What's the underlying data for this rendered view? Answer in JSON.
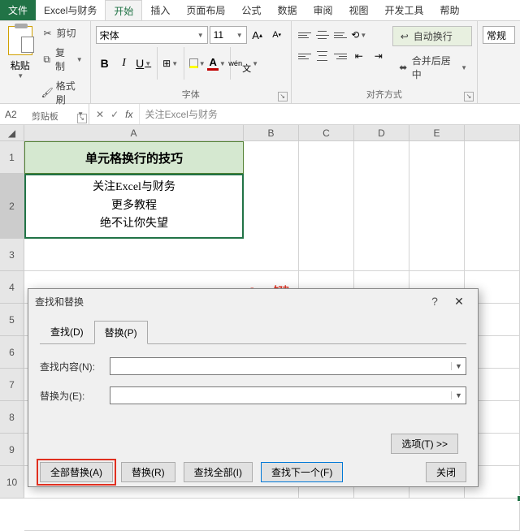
{
  "tabs": {
    "file": "文件",
    "context": "Excel与财务",
    "home": "开始",
    "insert": "插入",
    "layout": "页面布局",
    "formula": "公式",
    "data": "数据",
    "review": "审阅",
    "view": "视图",
    "dev": "开发工具",
    "help": "帮助"
  },
  "clipboard": {
    "paste": "粘贴",
    "cut": "剪切",
    "copy": "复制",
    "painter": "格式刷",
    "group": "剪贴板"
  },
  "font": {
    "family": "宋体",
    "size": "11",
    "group": "字体"
  },
  "align": {
    "wrap": "自动换行",
    "merge": "合并后居中",
    "group": "对齐方式"
  },
  "style_partial": "常规",
  "namebox": "A2",
  "formula": "关注Excel与财务",
  "a1": "单元格换行的技巧",
  "a2": {
    "l1": "关注Excel与财务",
    "l2": "更多教程",
    "l3": "绝不让你失望"
  },
  "cols": {
    "a": "A",
    "b": "B",
    "c": "C",
    "d": "D",
    "e": "E"
  },
  "rows": {
    "r1": "1",
    "r2": "2",
    "r3": "3",
    "r4": "4",
    "r5": "5",
    "r6": "6",
    "r7": "7",
    "r8": "8",
    "r9": "9",
    "r10": "10"
  },
  "dialog": {
    "title": "查找和替换",
    "tab_find": "查找(D)",
    "tab_replace": "替换(P)",
    "find_label": "查找内容(N):",
    "replace_label": "替换为(E):",
    "find_value": "",
    "replace_value": "",
    "options": "选项(T) >>",
    "replace_all": "全部替换(A)",
    "replace_btn": "替换(R)",
    "find_all": "查找全部(I)",
    "find_next": "查找下一个(F)",
    "close": "关闭"
  },
  "annotation": "Ctrl+J键"
}
